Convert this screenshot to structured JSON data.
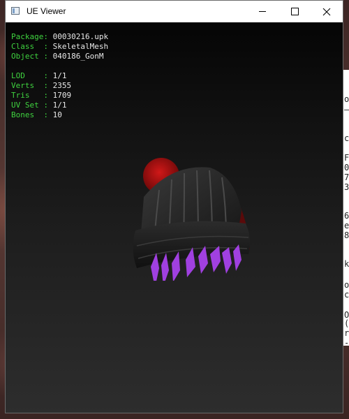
{
  "window": {
    "title": "UE Viewer"
  },
  "info": {
    "package_key": "Package:",
    "package_value": "00030216.upk",
    "class_key": "Class  :",
    "class_value": "SkeletalMesh",
    "object_key": "Object :",
    "object_value": "040186_GonM",
    "lod_key": "LOD    :",
    "lod_value": "1/1",
    "verts_key": "Verts  :",
    "verts_value": "2355",
    "tris_key": "Tris   :",
    "tris_value": "1709",
    "uvset_key": "UV Set :",
    "uvset_value": "1/1",
    "bones_key": "Bones  :",
    "bones_value": "10"
  },
  "side_panel": {
    "chars": [
      "o",
      "c",
      "F",
      "0",
      "7",
      "3",
      "6",
      "e",
      "8",
      "k",
      "o",
      "c",
      "O",
      "(",
      "r",
      "-"
    ]
  },
  "colors": {
    "label_green": "#3fd23f",
    "value_white": "#e8e8e8",
    "hat_dark": "#1e1e1e",
    "pompom_red": "#b01010",
    "hair_purple": "#a040e0"
  }
}
